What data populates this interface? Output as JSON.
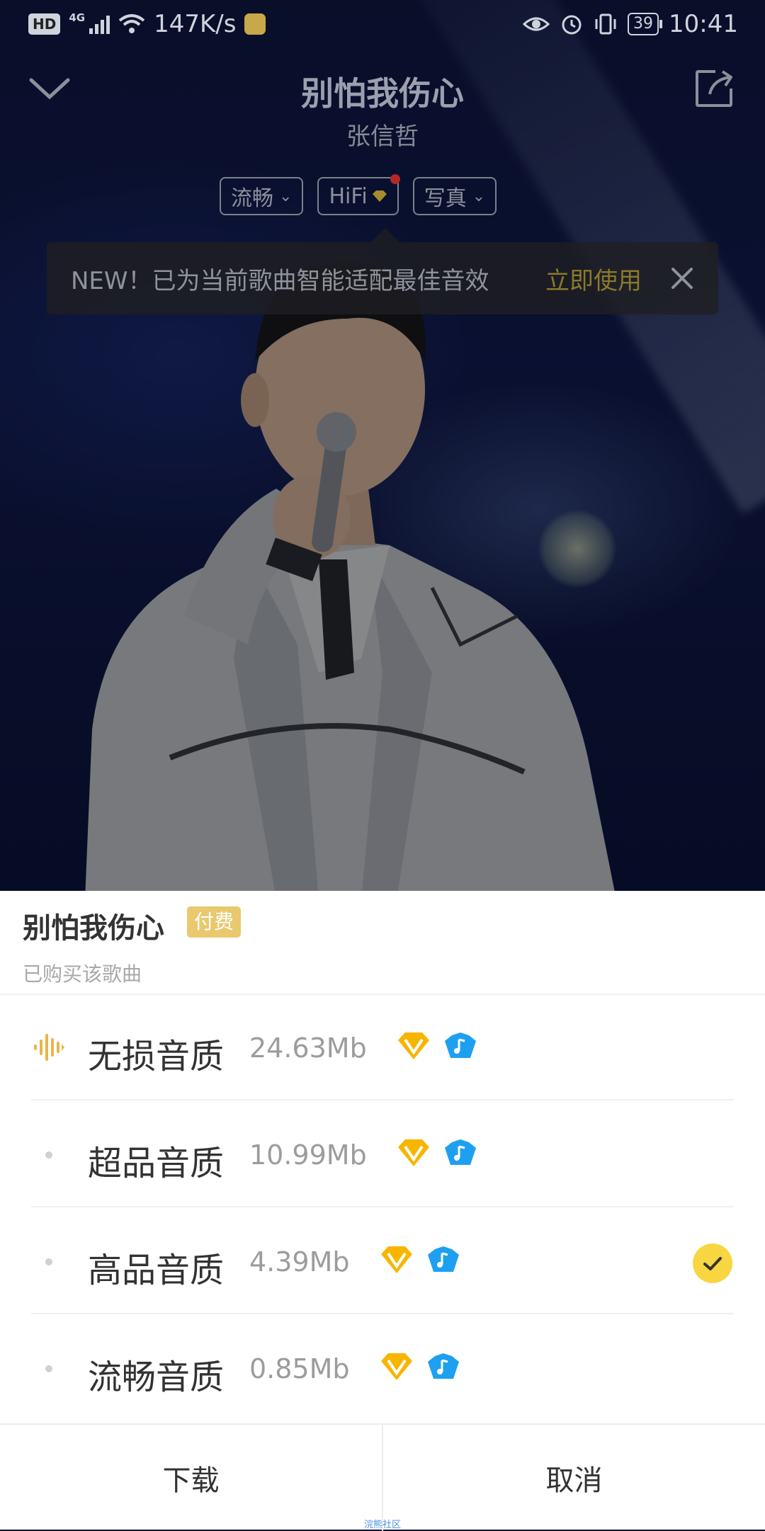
{
  "status_bar": {
    "hd": "HD",
    "network": "4G",
    "speed": "147K/s",
    "battery": "39",
    "time": "10:41"
  },
  "header": {
    "title": "别怕我伤心",
    "artist": "张信哲"
  },
  "pills": [
    {
      "label": "流畅"
    },
    {
      "label": "HiFi"
    },
    {
      "label": "写真"
    }
  ],
  "tip": {
    "text": "NEW！已为当前歌曲智能适配最佳音效",
    "action": "立即使用"
  },
  "sheet": {
    "title": "别怕我伤心",
    "badge": "付费",
    "subtitle": "已购买该歌曲",
    "qualities": [
      {
        "name": "无损音质",
        "size": "24.63Mb",
        "selected": false,
        "playing": true
      },
      {
        "name": "超品音质",
        "size": "10.99Mb",
        "selected": false,
        "playing": false
      },
      {
        "name": "高品音质",
        "size": "4.39Mb",
        "selected": true,
        "playing": false
      },
      {
        "name": "流畅音质",
        "size": "0.85Mb",
        "selected": false,
        "playing": false
      }
    ],
    "download_label": "下载",
    "cancel_label": "取消"
  },
  "watermark": "浣熊社区",
  "colors": {
    "accent_yellow": "#f8d641",
    "badge_gold": "#e9c86e",
    "tip_action": "#8a7a2a"
  }
}
